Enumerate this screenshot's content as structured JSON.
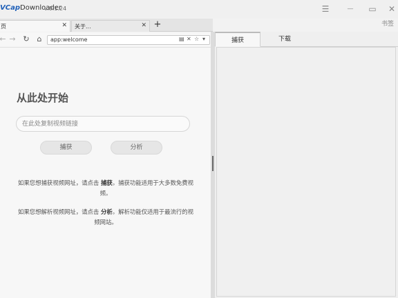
{
  "app": {
    "brand": "Cap",
    "brand_prefix": "V",
    "name": "Downloader",
    "version": "v.0.1.24",
    "bookmarks_label": "书签"
  },
  "window_controls": {
    "menu": "☰",
    "minimize": "—",
    "maximize": "▭",
    "close": "✕"
  },
  "tabs": [
    {
      "label": "页",
      "close": "✕"
    },
    {
      "label": "关于...",
      "close": "✕"
    }
  ],
  "new_tab": "+",
  "nav": {
    "back": "←",
    "forward": "→",
    "reload": "↻",
    "home": "⌂",
    "url": "app:welcome",
    "url_icons": [
      "▤",
      "✕",
      "☆",
      "▾"
    ]
  },
  "welcome": {
    "title": "从此处开始",
    "input_placeholder": "在此处复制视频链接",
    "capture_button": "捕获",
    "analyze_button": "分析",
    "para1_prefix": "如果您想捕获视频网址，请点击 ",
    "para1_bold": "捕获",
    "para1_suffix": "。捕获功能适用于大多数免费视频。",
    "para2_prefix": "如果您想解析视频网址，请点击 ",
    "para2_bold": "分析",
    "para2_suffix": "。解析功能仅适用于最流行的视频网站。"
  },
  "right_panel": {
    "tabs": [
      "捕获",
      "下载"
    ],
    "active_tab": "捕获"
  }
}
